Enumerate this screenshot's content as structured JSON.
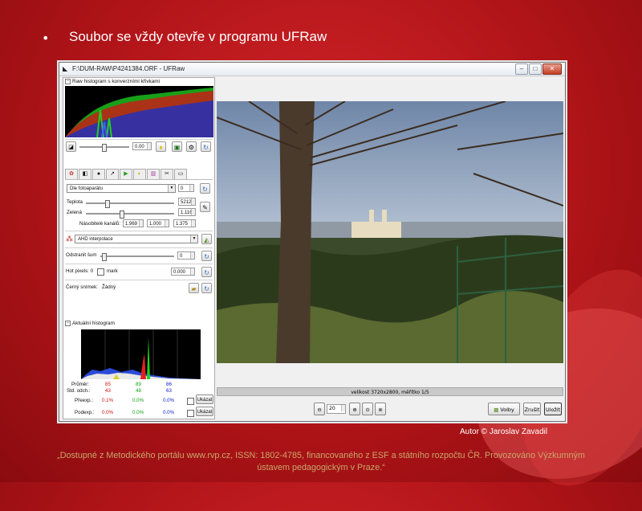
{
  "slide": {
    "bullet": "•",
    "heading": "Soubor se vždy otevře v programu UFRaw",
    "author": "Autor © Jaroslav Zavadil",
    "footer_line1": "„Dostupné z Metodického portálu www.rvp.cz, ISSN: 1802-4785, financovaného z ESF a státního rozpočtu ČR. Provozováno Výzkumným",
    "footer_line2": "ústavem pedagogickým v Praze.“",
    "colors": {
      "background": "#b01418",
      "footer_text": "#c9a66b",
      "heading_text": "#ffffff"
    }
  },
  "window": {
    "title": "F:\\DUM-RAW\\P4241384.ORF - UFRaw",
    "minimize": "–",
    "maximize": "□",
    "close": "✕"
  },
  "left_panel": {
    "raw_histogram_label": "Raw histogram s konverzními křivkami",
    "exposure_value": "0.00",
    "white_balance": {
      "preset": "Dle fotoaparátu",
      "preset_fine": "0",
      "temperature_label": "Teplota",
      "temperature_value": "5212",
      "green_label": "Zelená",
      "green_value": "1.116",
      "multipliers_label": "Násobitelé kanálů:",
      "mult_r": "1.969",
      "mult_g": "1.000",
      "mult_b": "1.375"
    },
    "interpolation": "AHD interpolace",
    "denoise_label": "Odstranit šum",
    "denoise_value": "0",
    "hot_pixels_label": "Hot pixels: 0",
    "mark_label": "mark",
    "hot_value": "0.000",
    "dark_frame_label": "Černý snímek:",
    "dark_frame_value": "Žádný",
    "live_histogram_label": "Aktuální histogram",
    "stats": {
      "mean_label": "Průměr:",
      "mean": [
        "85",
        "89",
        "86"
      ],
      "std_label": "Std. odch.:",
      "std": [
        "43",
        "48",
        "63"
      ],
      "over_label": "Přeexp.:",
      "over": [
        "0.1%",
        "0.0%",
        "0.0%"
      ],
      "under_label": "Podexp.:",
      "under": [
        "0.0%",
        "0.0%",
        "0.0%"
      ],
      "show_label": "Ukázat"
    }
  },
  "preview": {
    "status": "velikost 3720x2800, měřítko 1/5",
    "zoom_value": "20",
    "options_button": "Volby",
    "cancel_button": "Zrušit",
    "save_button": "Uložit"
  }
}
